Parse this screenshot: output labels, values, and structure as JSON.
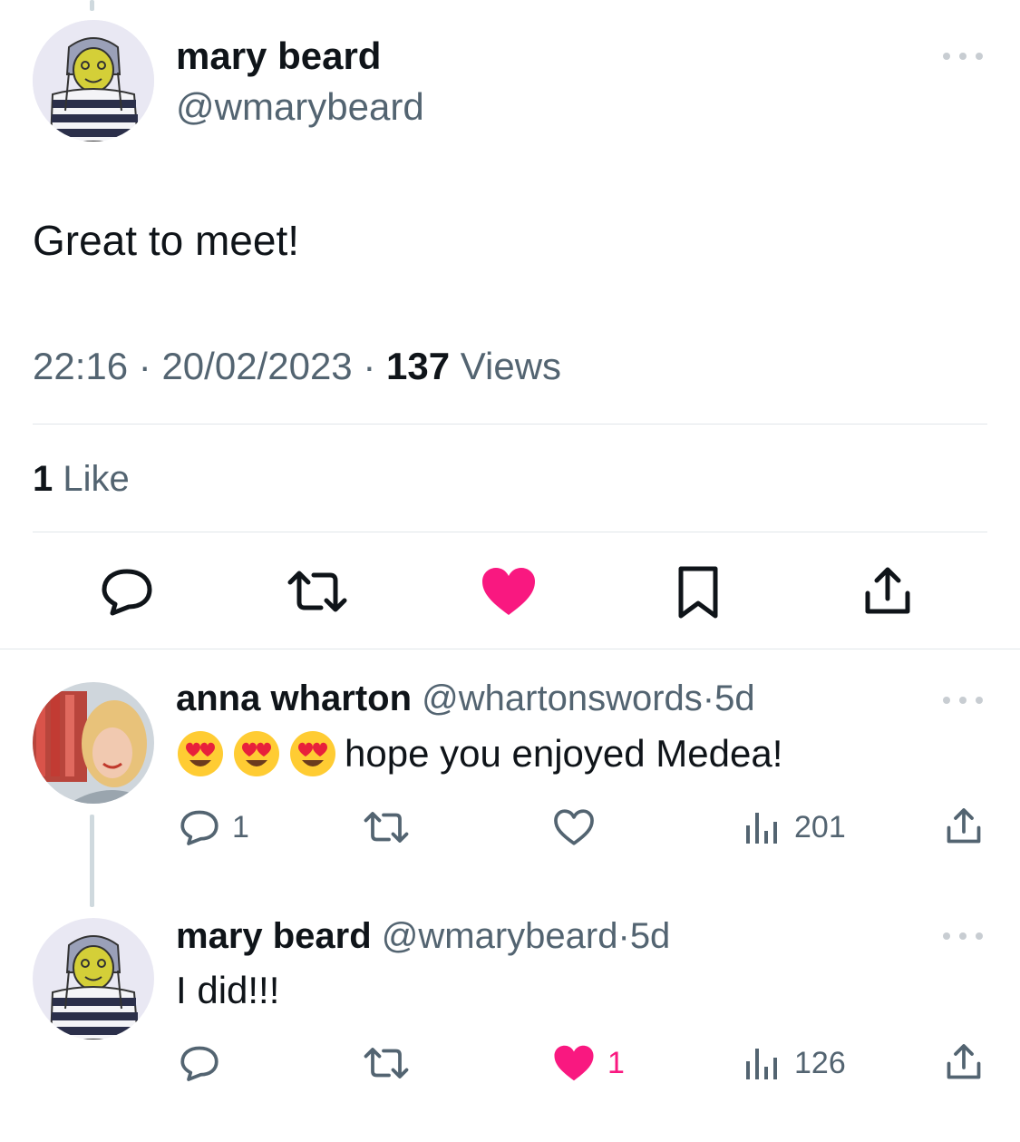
{
  "main_tweet": {
    "author_name": "mary beard",
    "author_handle": "@wmarybeard",
    "text": "Great to meet!",
    "time": "22:16",
    "date": "20/02/2023",
    "views_count": "137",
    "views_label": "Views",
    "likes_count": "1",
    "likes_label": "Like",
    "liked": true
  },
  "replies": [
    {
      "author_name": "anna wharton",
      "author_handle": "@whartonswords",
      "age": "5d",
      "emoji": [
        "heart-eyes",
        "heart-eyes",
        "heart-eyes"
      ],
      "text": "hope you enjoyed Medea!",
      "reply_count": "1",
      "like_count": "",
      "views": "201",
      "liked": false
    },
    {
      "author_name": "mary beard",
      "author_handle": "@wmarybeard",
      "age": "5d",
      "text": "I did!!!",
      "reply_count": "",
      "like_count": "1",
      "views": "126",
      "liked": true
    }
  ],
  "separator": "·",
  "colors": {
    "like_pink": "#f91880",
    "icon_gray": "#536471",
    "text": "#0f1419"
  }
}
